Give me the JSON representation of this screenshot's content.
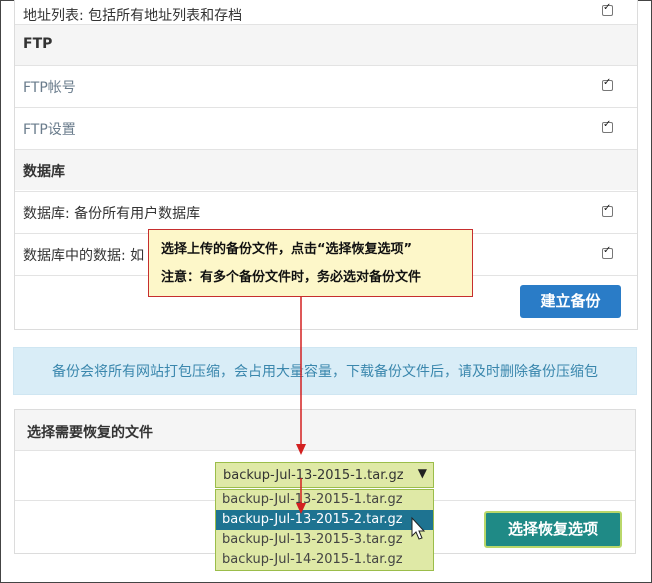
{
  "backup_items": [
    {
      "label": "地址列表: 包括所有地址列表和存档",
      "type": "item",
      "checked": true
    },
    {
      "label": "FTP",
      "type": "header"
    },
    {
      "label": "FTP帐号",
      "type": "item",
      "checked": true
    },
    {
      "label": "FTP设置",
      "type": "item",
      "checked": true
    },
    {
      "label": "数据库",
      "type": "header"
    },
    {
      "label": "数据库: 备份所有用户数据库",
      "type": "item",
      "checked": true
    },
    {
      "label": "数据库中的数据: 如",
      "type": "item",
      "checked": true
    }
  ],
  "create_backup_label": "建立备份",
  "info_text": "备份会将所有网站打包压缩，会占用大量容量，下载备份文件后，请及时删除备份压缩包",
  "restore": {
    "title": "选择需要恢复的文件",
    "selected_value": "backup-Jul-13-2015-1.tar.gz",
    "arrow_symbol": "▼",
    "options": [
      "backup-Jul-13-2015-1.tar.gz",
      "backup-Jul-13-2015-2.tar.gz",
      "backup-Jul-13-2015-3.tar.gz",
      "backup-Jul-14-2015-1.tar.gz"
    ],
    "highlighted_option_index": 1,
    "restore_button_label": "选择恢复选项"
  },
  "callout": {
    "line1": "选择上传的备份文件，点击“选择恢复选项”",
    "line2": "注意：有多个备份文件时，务必选对备份文件"
  },
  "colors": {
    "primary_button": "#2a7cc7",
    "restore_button": "#1f8a86",
    "info_bg": "#d9edf7",
    "info_text": "#3a87ad",
    "callout_border": "#c62e2e",
    "callout_bg": "#fdf7c9",
    "dropdown_bg": "#dfe9a6",
    "dropdown_selected": "#1e7391"
  }
}
